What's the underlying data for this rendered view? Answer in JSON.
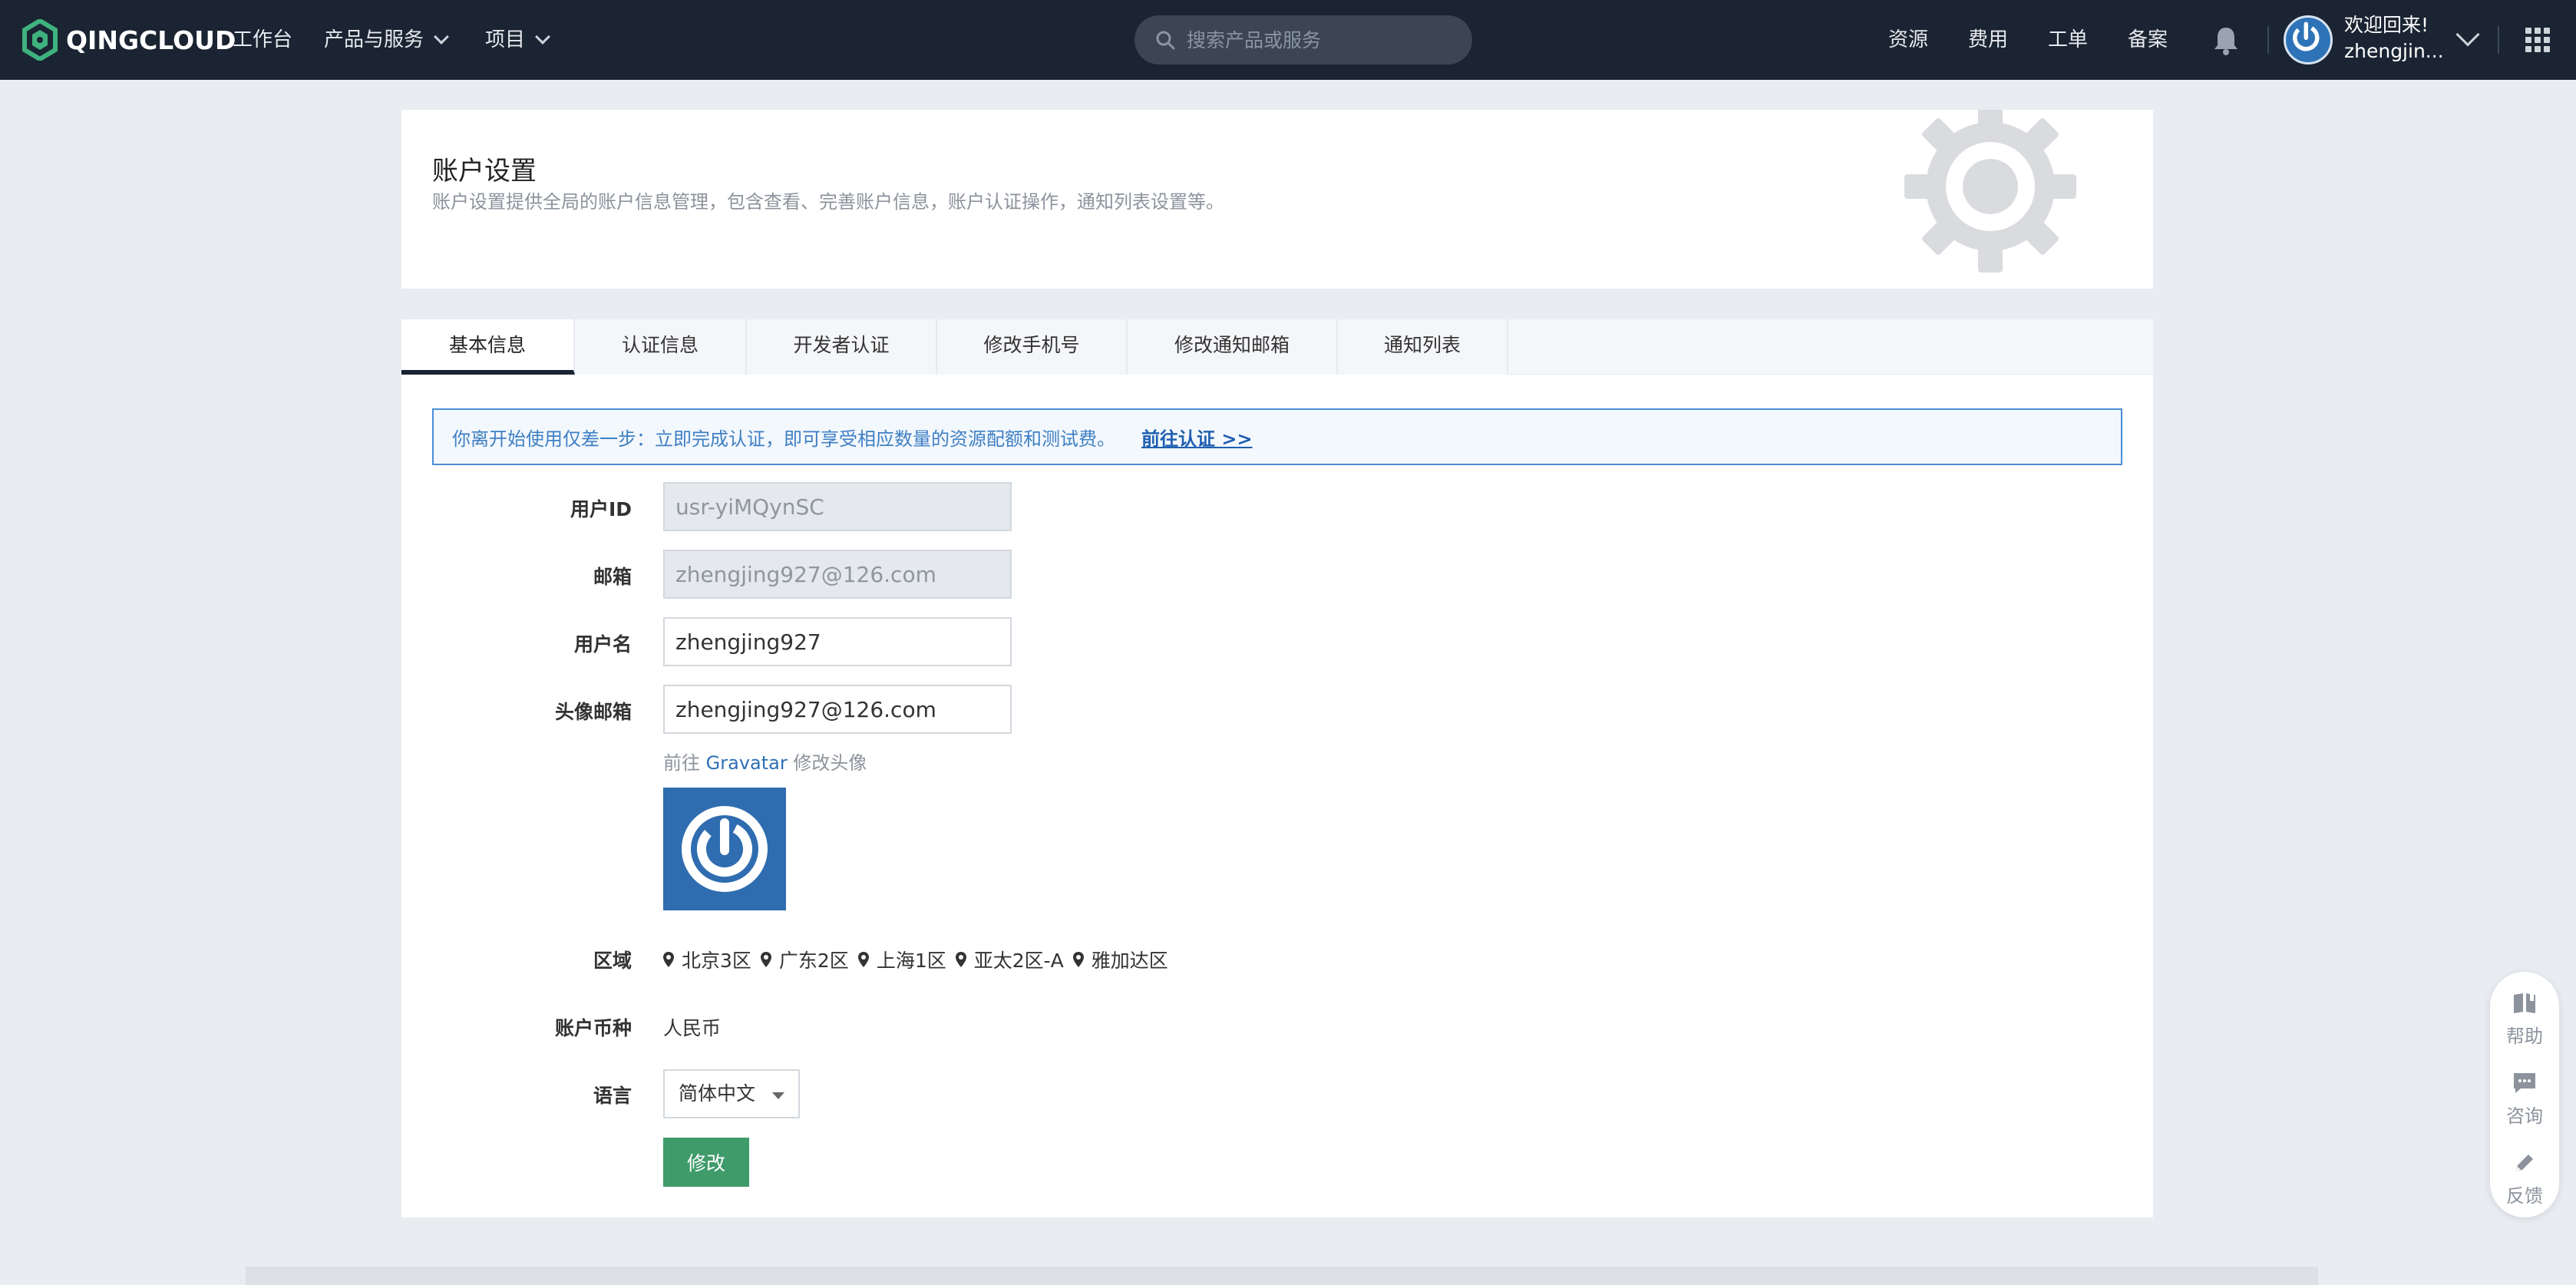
{
  "topbar": {
    "brand": "QINGCLOUD",
    "nav": [
      {
        "label": "工作台"
      },
      {
        "label": "产品与服务"
      },
      {
        "label": "项目"
      }
    ],
    "search_placeholder": "搜索产品或服务",
    "links": [
      "资源",
      "费用",
      "工单",
      "备案"
    ],
    "welcome": "欢迎回来!",
    "username": "zhengjin..."
  },
  "header": {
    "title": "账户设置",
    "description": "账户设置提供全局的账户信息管理，包含查看、完善账户信息，账户认证操作，通知列表设置等。"
  },
  "tabs": [
    "基本信息",
    "认证信息",
    "开发者认证",
    "修改手机号",
    "修改通知邮箱",
    "通知列表"
  ],
  "notice": {
    "text": "你离开始使用仅差一步：立即完成认证，即可享受相应数量的资源配额和测试费。",
    "link": "前往认证 >>"
  },
  "form": {
    "user_id_label": "用户ID",
    "user_id_value": "usr-yiMQynSC",
    "email_label": "邮箱",
    "email_value": "zhengjing927@126.com",
    "username_label": "用户名",
    "username_value": "zhengjing927",
    "avatar_email_label": "头像邮箱",
    "avatar_email_value": "zhengjing927@126.com",
    "gravatar_prefix": "前往",
    "gravatar_link": "Gravatar",
    "gravatar_suffix": "修改头像",
    "zone_label": "区域",
    "zones": [
      "北京3区",
      "广东2区",
      "上海1区",
      "亚太2区-A",
      "雅加达区"
    ],
    "currency_label": "账户币种",
    "currency_value": "人民币",
    "language_label": "语言",
    "language_value": "简体中文",
    "submit_label": "修改"
  },
  "float": {
    "help": "帮助",
    "consult": "咨询",
    "feedback": "反馈"
  }
}
